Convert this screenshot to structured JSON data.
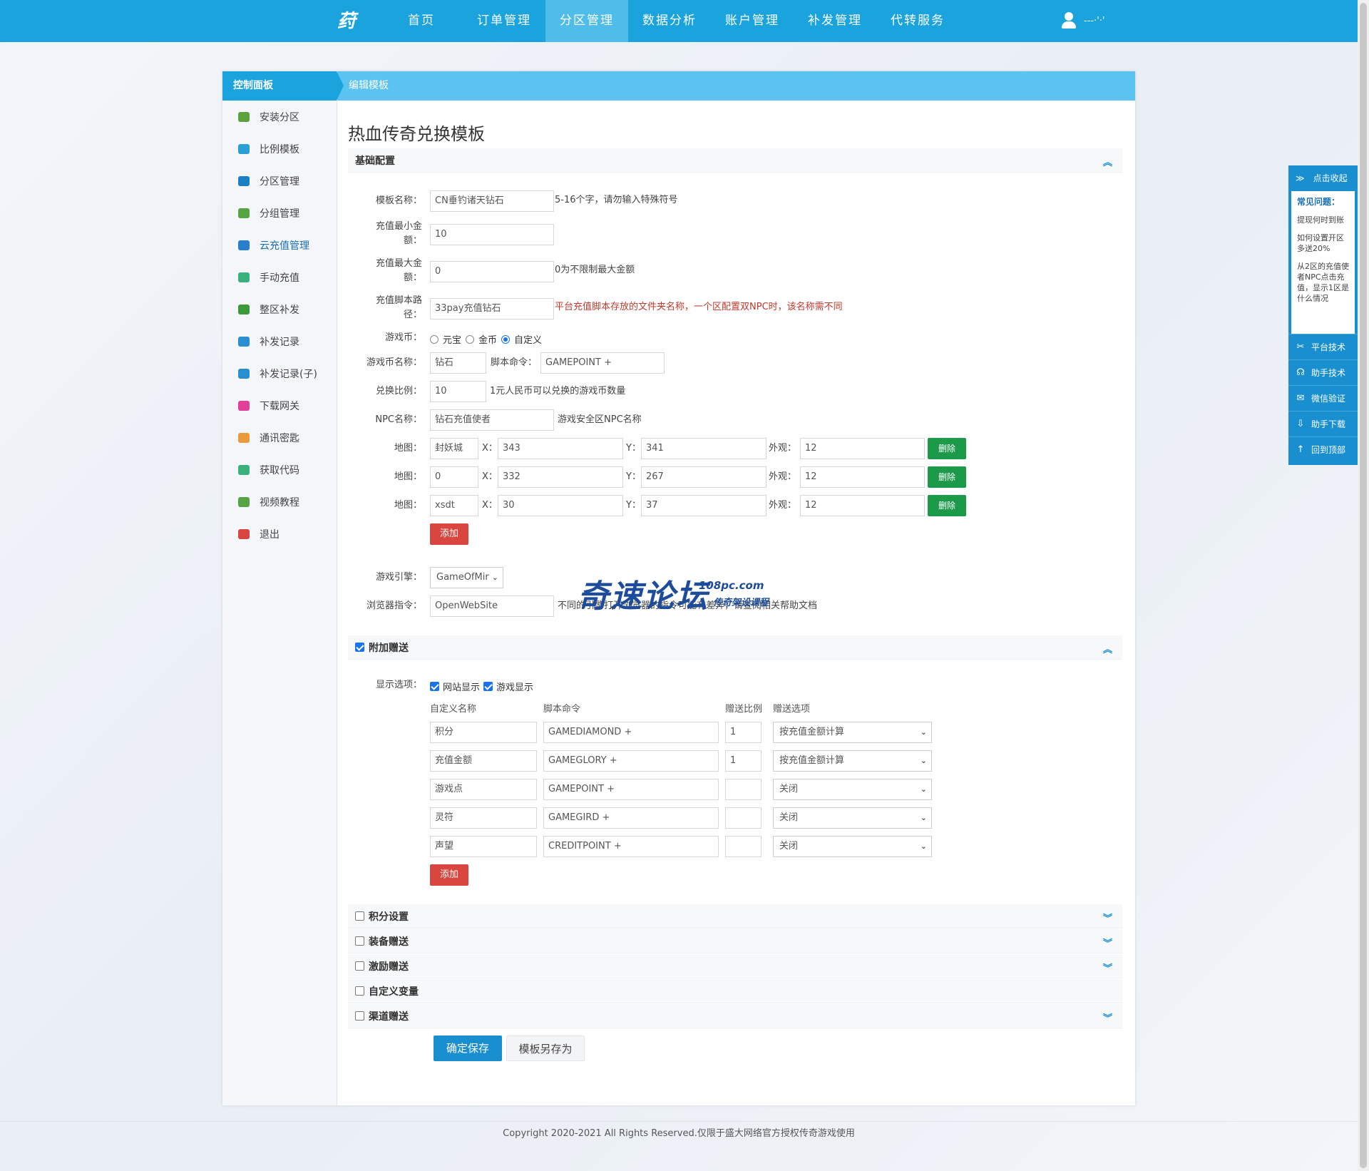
{
  "topnav": {
    "logo": "荮",
    "items": [
      "首页",
      "订单管理",
      "分区管理",
      "数据分析",
      "账户管理",
      "补发管理",
      "代转服务"
    ],
    "active_index": 2,
    "username": "---·'·'"
  },
  "sidebar": {
    "header": "控制面板",
    "items": [
      {
        "label": "安装分区",
        "icon": "wrench-icon",
        "color": "#5aa33a"
      },
      {
        "label": "比例模板",
        "icon": "copy-icon",
        "color": "#2a9fd6"
      },
      {
        "label": "分区管理",
        "icon": "inbox-icon",
        "color": "#1a7fc4"
      },
      {
        "label": "分组管理",
        "icon": "users-icon",
        "color": "#56a545"
      },
      {
        "label": "云充值管理",
        "icon": "user-icon",
        "color": "#2a7fcc"
      },
      {
        "label": "手动充值",
        "icon": "send-icon",
        "color": "#3ab07a"
      },
      {
        "label": "整区补发",
        "icon": "calendar-icon",
        "color": "#3a9a3a"
      },
      {
        "label": "补发记录",
        "icon": "copy-icon",
        "color": "#2a8fd0"
      },
      {
        "label": "补发记录(子)",
        "icon": "copy-icon",
        "color": "#2a8fd0"
      },
      {
        "label": "下载网关",
        "icon": "box-icon",
        "color": "#e0409a"
      },
      {
        "label": "通讯密匙",
        "icon": "key-icon",
        "color": "#e99a3a"
      },
      {
        "label": "获取代码",
        "icon": "briefcase-icon",
        "color": "#3ab07a"
      },
      {
        "label": "视频教程",
        "icon": "video-icon",
        "color": "#56a545"
      },
      {
        "label": "退出",
        "icon": "power-icon",
        "color": "#d9453f"
      }
    ],
    "active_index": 4
  },
  "main": {
    "header": "编辑模板",
    "title": "热血传奇兑换模板",
    "basic": {
      "section_title": "基础配置",
      "name_label": "模板名称：",
      "name_value": "CN垂钓诸天钻石",
      "name_hint": "5-16个字，请勿输入特殊符号",
      "min_label_1": "充值最小金",
      "min_label_2": "额：",
      "min_value": "10",
      "max_label_1": "充值最大金",
      "max_label_2": "额：",
      "max_value": "0",
      "max_hint": "0为不限制最大金额",
      "script_label_1": "充值脚本路",
      "script_label_2": "径：",
      "script_value": "33pay充值钻石",
      "script_hint": "平台充值脚本存放的文件夹名称，一个区配置双NPC时，该名称需不同",
      "currency_label": "游戏币：",
      "currency_options": [
        "元宝",
        "金币",
        "自定义"
      ],
      "currency_selected": 2,
      "coin_name_label": "游戏币名称：",
      "coin_name_value": "钻石",
      "cmd_label": "脚本命令：",
      "cmd_value": "GAMEPOINT +",
      "ratio_label": "兑换比例：",
      "ratio_value": "10",
      "ratio_hint": "1元人民币可以兑换的游戏币数量",
      "npc_label": "NPC名称：",
      "npc_value": "钻石充值使者",
      "npc_hint": "游戏安全区NPC名称",
      "map_label": "地图：",
      "x_label": "X：",
      "y_label": "Y：",
      "look_label": "外观：",
      "delete_label": "删除",
      "maps": [
        {
          "map": "封妖城",
          "x": "343",
          "y": "341",
          "look": "12"
        },
        {
          "map": "0",
          "x": "332",
          "y": "267",
          "look": "12"
        },
        {
          "map": "xsdt",
          "x": "30",
          "y": "37",
          "look": "12"
        }
      ],
      "add_label": "添加",
      "engine_label": "游戏引擎：",
      "engine_value": "GameOfMir",
      "browser_label": "浏览器指令：",
      "browser_value": "OpenWebSite",
      "browser_hint": "不同的引擎打开浏览器的指令可能有差异，请查阅相关帮助文档"
    },
    "bonus": {
      "section_title": "附加赠送",
      "display_label": "显示选项：",
      "display_options": [
        "网站显示",
        "游戏显示"
      ],
      "col_name": "自定义名称",
      "col_cmd": "脚本命令",
      "col_ratio": "赠送比例",
      "col_option": "赠送选项",
      "rows": [
        {
          "name": "积分",
          "cmd": "GAMEDIAMOND +",
          "ratio": "1",
          "option": "按充值金额计算"
        },
        {
          "name": "充值金额",
          "cmd": "GAMEGLORY +",
          "ratio": "1",
          "option": "按充值金额计算"
        },
        {
          "name": "游戏点",
          "cmd": "GAMEPOINT +",
          "ratio": "",
          "option": "关闭"
        },
        {
          "name": "灵符",
          "cmd": "GAMEGIRD +",
          "ratio": "",
          "option": "关闭"
        },
        {
          "name": "声望",
          "cmd": "CREDITPOINT +",
          "ratio": "",
          "option": "关闭"
        }
      ],
      "add_label": "添加"
    },
    "collapsed_sections": [
      "积分设置",
      "装备赠送",
      "激励赠送",
      "自定义变量",
      "渠道赠送"
    ],
    "save_label": "确定保存",
    "saveas_label": "模板另存为"
  },
  "watermark": {
    "main": "奇速论坛",
    "url": "108pc.com",
    "sub": "传奇架设课程"
  },
  "footer": "Copyright 2020-2021 All Rights Reserved.仅限于盛大网络官方授权传奇游戏使用",
  "float_panel": {
    "collapse_label": "点击收起",
    "faq_title": "常见问题：",
    "faq_items": [
      "提现何时到账",
      "如何设置开区多送20%",
      "从2区的充值使者NPC点击充值，显示1区是什么情况"
    ],
    "links": [
      "平台技术",
      "助手技术",
      "微信验证",
      "助手下载",
      "回到顶部"
    ]
  },
  "colors": {
    "primary": "#1aa3dc",
    "header_light": "#5bc3ef",
    "danger": "#d9453f",
    "success": "#1c9a4a",
    "save": "#1a8fd0"
  }
}
